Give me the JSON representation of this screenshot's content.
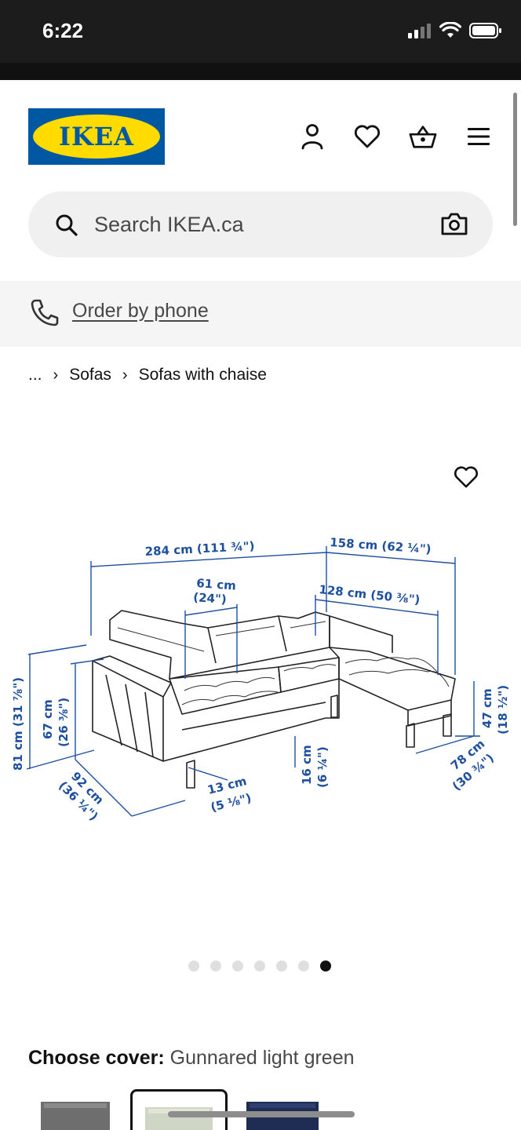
{
  "status_bar": {
    "time": "6:22"
  },
  "header": {
    "logo_text": "IKEA",
    "icons": [
      "user-icon",
      "heart-icon",
      "basket-icon",
      "menu-icon"
    ]
  },
  "search": {
    "placeholder": "Search IKEA.ca"
  },
  "phone": {
    "link_label": "Order by phone"
  },
  "breadcrumb": {
    "ellipsis": "...",
    "items": [
      "Sofas",
      "Sofas with chaise"
    ]
  },
  "diagram": {
    "total_width": "284 cm (111 ¾\")",
    "chaise_width": "158 cm (62 ¼\")",
    "seat_width": "61 cm",
    "seat_width_in": "(24\")",
    "chaise_seat_width": "128 cm (50 ⅜\")",
    "height": "81 cm (31 ⅞\")",
    "seat_height": "67 cm",
    "seat_height_in": "(26 ⅜\")",
    "depth": "92 cm",
    "depth_in": "(36 ¼\")",
    "leg_height": "13 cm",
    "leg_height_in": "(5 ⅛\")",
    "clearance": "16 cm",
    "clearance_in": "(6 ¼\")",
    "chaise_height": "47 cm",
    "chaise_height_in": "(18 ½\")",
    "chaise_depth": "78 cm",
    "chaise_depth_in": "(30 ¾\")"
  },
  "carousel": {
    "count": 7,
    "active_index": 6
  },
  "cover": {
    "label": "Choose cover:",
    "value": "Gunnared light green"
  },
  "colors": {
    "ikea_blue": "#0058a3",
    "ikea_yellow": "#ffdb00",
    "dim_blue": "#1d4fa0"
  }
}
